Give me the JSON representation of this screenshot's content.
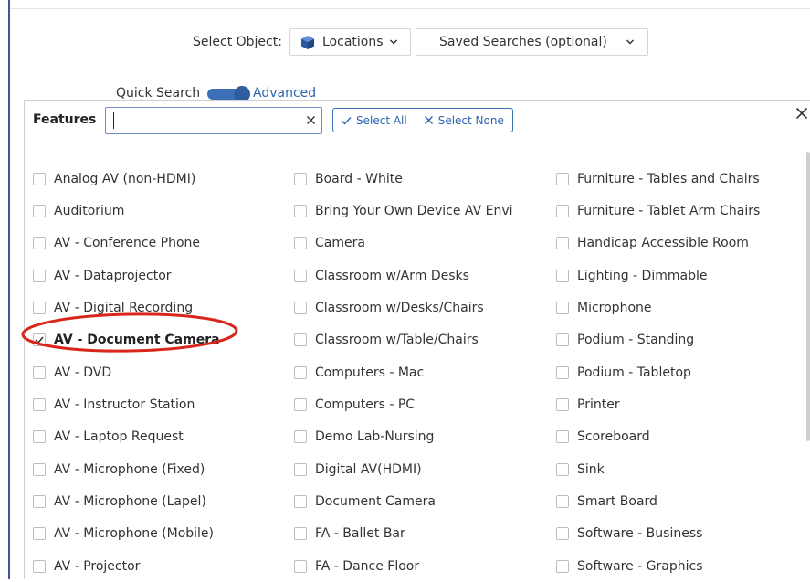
{
  "search": {
    "select_object_label": "Select Object:",
    "object_value": "Locations",
    "saved_searches_value": "Saved Searches (optional)",
    "quick_search_label": "Quick Search",
    "advanced_label": "Advanced"
  },
  "features": {
    "title": "Features",
    "filter_value": "",
    "select_all_label": "Select All",
    "select_none_label": "Select None",
    "columns": [
      [
        {
          "label": "Analog AV (non-HDMI)",
          "checked": false
        },
        {
          "label": "Auditorium",
          "checked": false
        },
        {
          "label": "AV - Conference Phone",
          "checked": false
        },
        {
          "label": "AV - Dataprojector",
          "checked": false
        },
        {
          "label": "AV - Digital Recording",
          "checked": false
        },
        {
          "label": "AV - Document Camera",
          "checked": true
        },
        {
          "label": "AV - DVD",
          "checked": false
        },
        {
          "label": "AV - Instructor Station",
          "checked": false
        },
        {
          "label": "AV - Laptop Request",
          "checked": false
        },
        {
          "label": "AV - Microphone (Fixed)",
          "checked": false
        },
        {
          "label": "AV - Microphone (Lapel)",
          "checked": false
        },
        {
          "label": "AV - Microphone (Mobile)",
          "checked": false
        },
        {
          "label": "AV - Projector",
          "checked": false
        }
      ],
      [
        {
          "label": "Board - White",
          "checked": false
        },
        {
          "label": "Bring Your Own Device AV Envi",
          "checked": false
        },
        {
          "label": "Camera",
          "checked": false
        },
        {
          "label": "Classroom w/Arm Desks",
          "checked": false
        },
        {
          "label": "Classroom w/Desks/Chairs",
          "checked": false
        },
        {
          "label": "Classroom w/Table/Chairs",
          "checked": false
        },
        {
          "label": "Computers - Mac",
          "checked": false
        },
        {
          "label": "Computers - PC",
          "checked": false
        },
        {
          "label": "Demo Lab-Nursing",
          "checked": false
        },
        {
          "label": "Digital AV(HDMI)",
          "checked": false
        },
        {
          "label": "Document Camera",
          "checked": false
        },
        {
          "label": "FA - Ballet Bar",
          "checked": false
        },
        {
          "label": "FA - Dance Floor",
          "checked": false
        }
      ],
      [
        {
          "label": "Furniture - Tables and Chairs",
          "checked": false
        },
        {
          "label": "Furniture - Tablet Arm Chairs",
          "checked": false
        },
        {
          "label": "Handicap Accessible Room",
          "checked": false
        },
        {
          "label": "Lighting - Dimmable",
          "checked": false
        },
        {
          "label": "Microphone",
          "checked": false
        },
        {
          "label": "Podium - Standing",
          "checked": false
        },
        {
          "label": "Podium - Tabletop",
          "checked": false
        },
        {
          "label": "Printer",
          "checked": false
        },
        {
          "label": "Scoreboard",
          "checked": false
        },
        {
          "label": "Sink",
          "checked": false
        },
        {
          "label": "Smart Board",
          "checked": false
        },
        {
          "label": "Software - Business",
          "checked": false
        },
        {
          "label": "Software - Graphics",
          "checked": false
        }
      ]
    ]
  },
  "colors": {
    "accent": "#2b64b1",
    "toggle": "#3d6fb6",
    "highlight_ring": "#d9261c"
  }
}
